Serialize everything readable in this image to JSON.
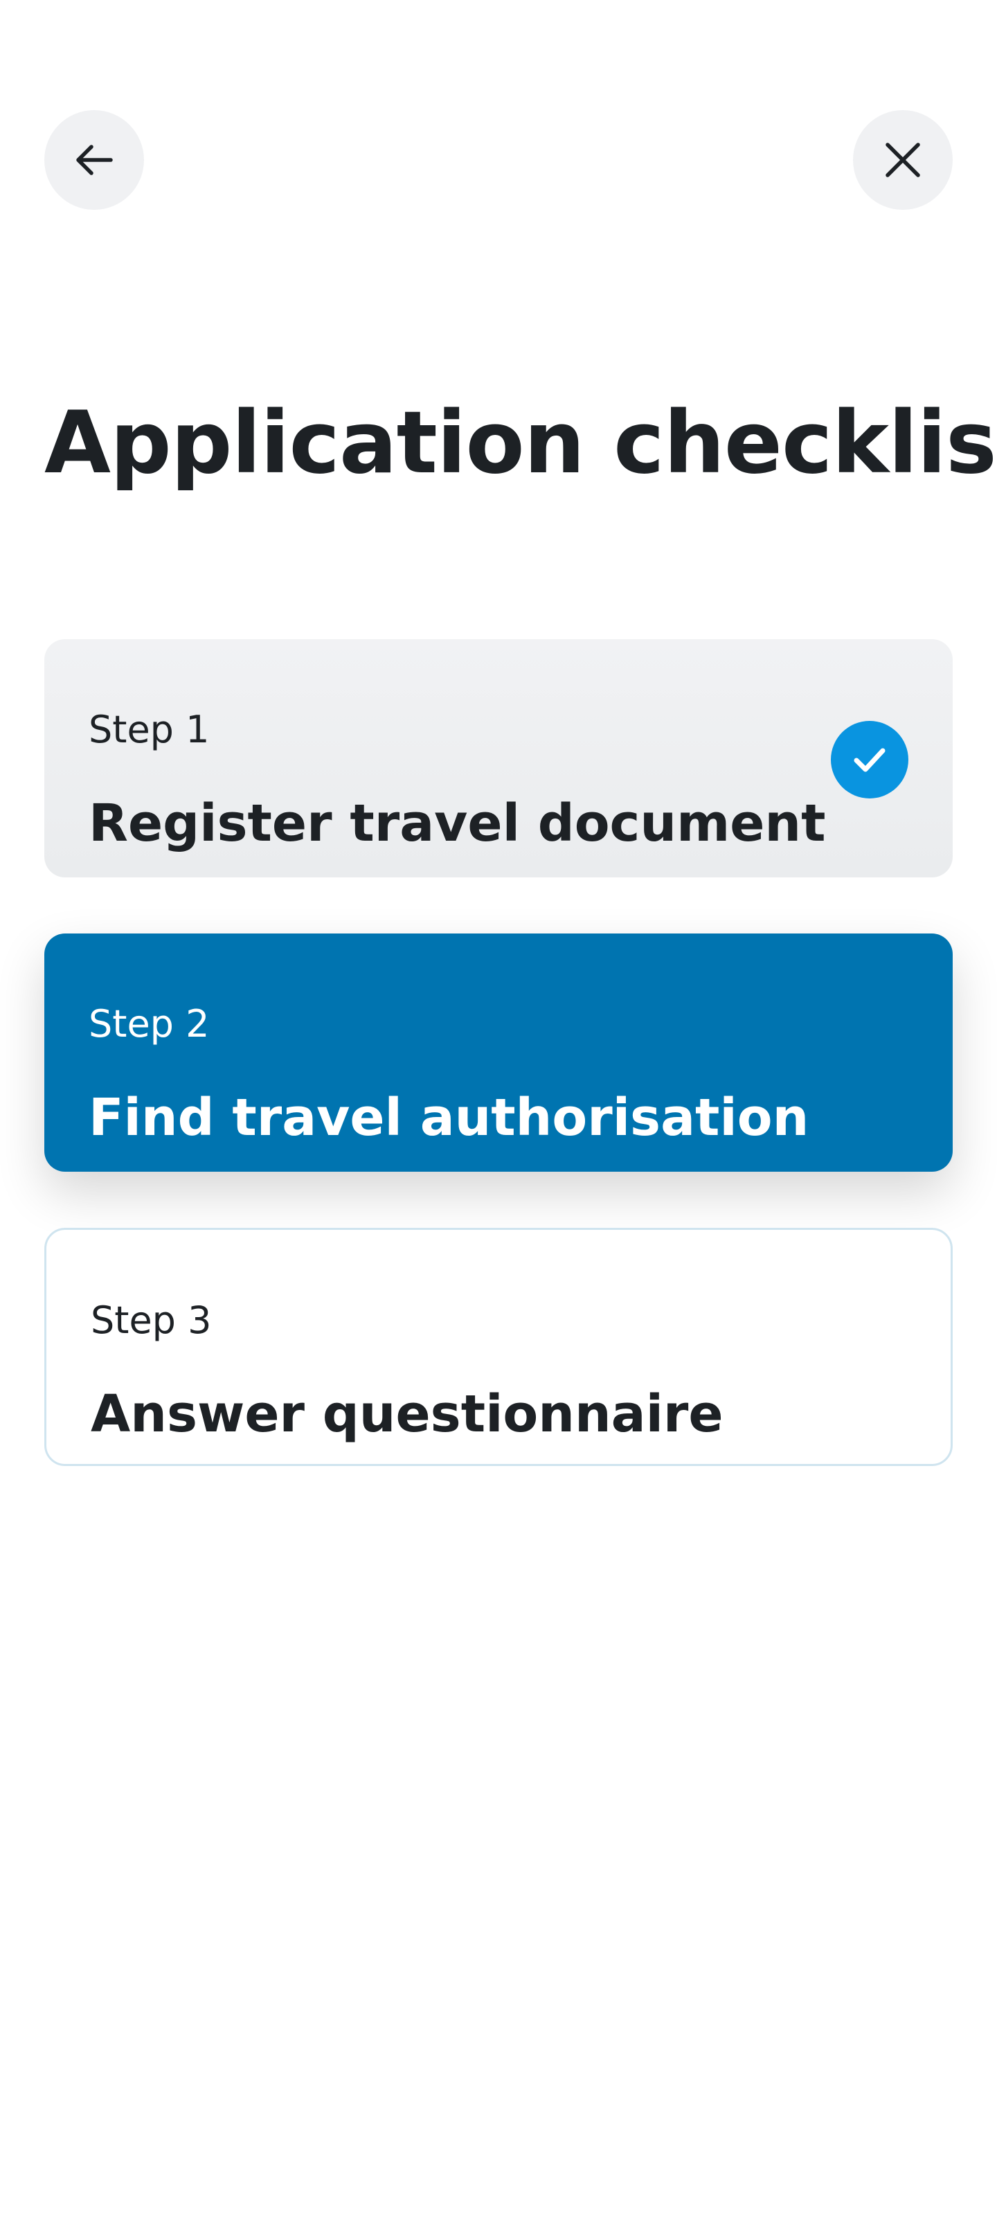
{
  "header": {
    "back_icon": "arrow-left-icon",
    "close_icon": "close-icon"
  },
  "page_title": "Application checklist",
  "steps": [
    {
      "label": "Step 1",
      "title": "Register travel document",
      "status": "completed",
      "status_icon": "checkmark-icon"
    },
    {
      "label": "Step 2",
      "title": "Find travel authorisation",
      "status": "current"
    },
    {
      "label": "Step 3",
      "title": "Answer questionnaire",
      "status": "upcoming"
    }
  ],
  "colors": {
    "accent": "#0074b0",
    "check_badge": "#0994e0",
    "completed_card": "#f1f2f4",
    "upcoming_border": "#cfe4ef",
    "text": "#1d2125"
  }
}
